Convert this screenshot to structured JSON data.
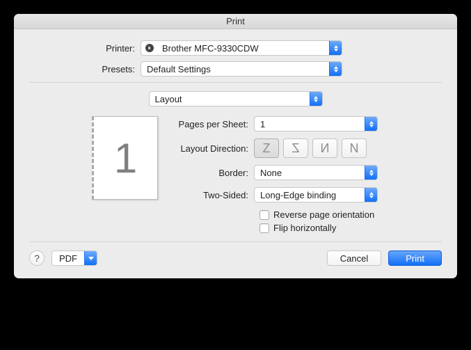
{
  "window_title": "Print",
  "printer": {
    "label": "Printer:",
    "value": "Brother MFC-9330CDW"
  },
  "presets": {
    "label": "Presets:",
    "value": "Default Settings"
  },
  "panel": {
    "value": "Layout"
  },
  "layout": {
    "pages_per_sheet": {
      "label": "Pages per Sheet:",
      "value": "1"
    },
    "layout_direction": {
      "label": "Layout Direction:"
    },
    "border": {
      "label": "Border:",
      "value": "None"
    },
    "two_sided": {
      "label": "Two-Sided:",
      "value": "Long-Edge binding"
    },
    "reverse": {
      "label": "Reverse page orientation",
      "checked": false
    },
    "flip": {
      "label": "Flip horizontally",
      "checked": false
    }
  },
  "preview_page_number": "1",
  "footer": {
    "pdf": "PDF",
    "cancel": "Cancel",
    "print": "Print",
    "help": "?"
  }
}
